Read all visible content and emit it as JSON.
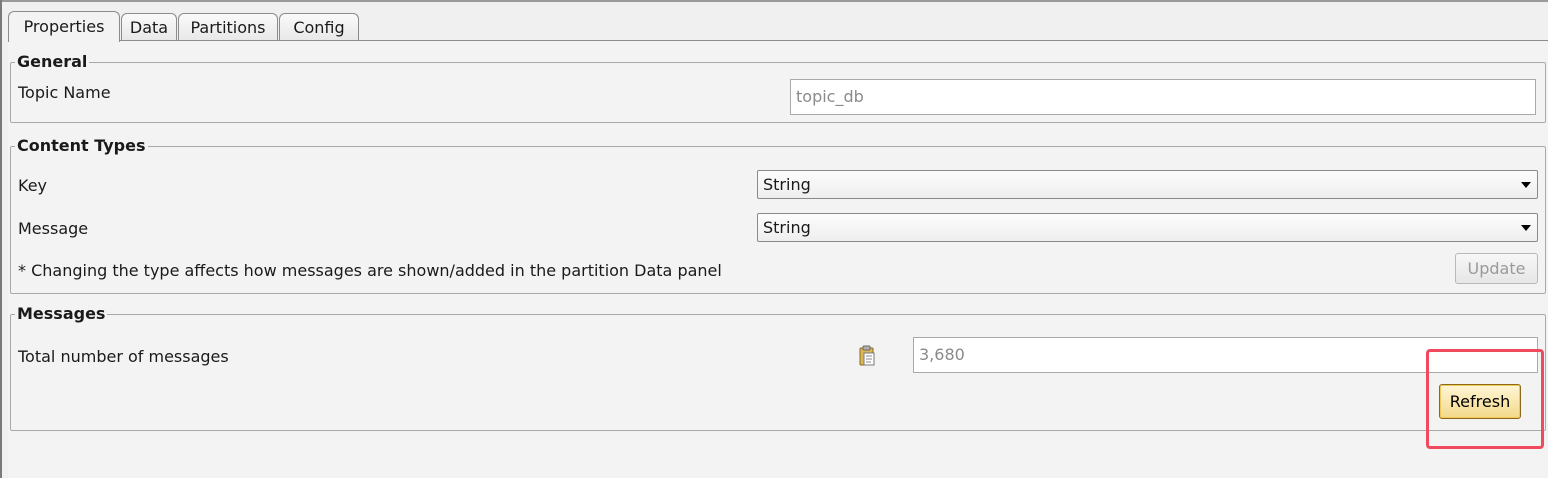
{
  "tabs": [
    {
      "label": "Properties",
      "active": true
    },
    {
      "label": "Data",
      "active": false
    },
    {
      "label": "Partitions",
      "active": false
    },
    {
      "label": "Config",
      "active": false
    }
  ],
  "general": {
    "legend": "General",
    "topic_name_label": "Topic Name",
    "topic_name_value": "topic_db"
  },
  "content_types": {
    "legend": "Content Types",
    "key_label": "Key",
    "key_value": "String",
    "message_label": "Message",
    "message_value": "String",
    "note": "* Changing the type affects how messages are shown/added in the partition Data panel",
    "update_label": "Update"
  },
  "messages": {
    "legend": "Messages",
    "total_label": "Total number of messages",
    "total_value": "3,680",
    "refresh_label": "Refresh",
    "copy_icon": "clipboard-icon"
  },
  "colors": {
    "highlight": "#f04a5e"
  }
}
